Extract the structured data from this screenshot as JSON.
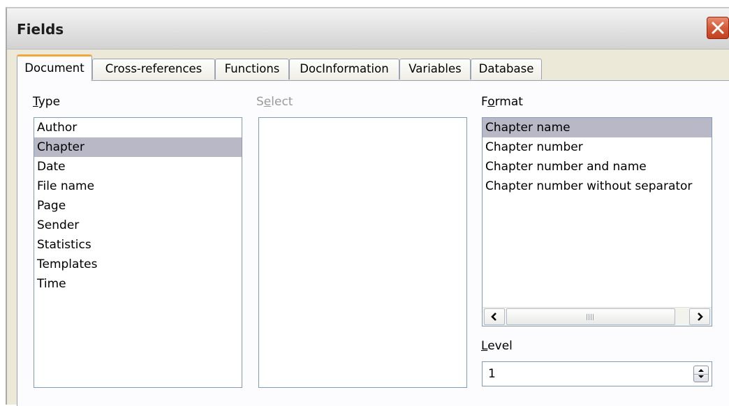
{
  "window": {
    "title": "Fields"
  },
  "tabs": [
    {
      "label": "Document",
      "active": true
    },
    {
      "label": "Cross-references",
      "active": false
    },
    {
      "label": "Functions",
      "active": false
    },
    {
      "label": "DocInformation",
      "active": false
    },
    {
      "label": "Variables",
      "active": false
    },
    {
      "label": "Database",
      "active": false
    }
  ],
  "type": {
    "label_mnemonic": "T",
    "label_rest": "ype",
    "items": [
      "Author",
      "Chapter",
      "Date",
      "File name",
      "Page",
      "Sender",
      "Statistics",
      "Templates",
      "Time"
    ],
    "selected": "Chapter"
  },
  "select": {
    "label_pre": "S",
    "label_mnemonic": "e",
    "label_rest": "lect",
    "disabled": true,
    "items": []
  },
  "format": {
    "label_pre": "F",
    "label_mnemonic": "o",
    "label_rest": "rmat",
    "items": [
      "Chapter name",
      "Chapter number",
      "Chapter number and name",
      "Chapter number without separator"
    ],
    "selected": "Chapter name"
  },
  "level": {
    "label_mnemonic": "L",
    "label_rest": "evel",
    "value": "1"
  },
  "icons": {
    "close": "close-icon",
    "scroll_left": "chevron-left-icon",
    "scroll_right": "chevron-right-icon",
    "spin_up": "chevron-up-icon",
    "spin_down": "chevron-down-icon"
  },
  "colors": {
    "selection": "#b8b8c7",
    "active_tab_accent": "#f2a63b",
    "close_button": "#d45b38",
    "listbox_border": "#7f9db9"
  }
}
